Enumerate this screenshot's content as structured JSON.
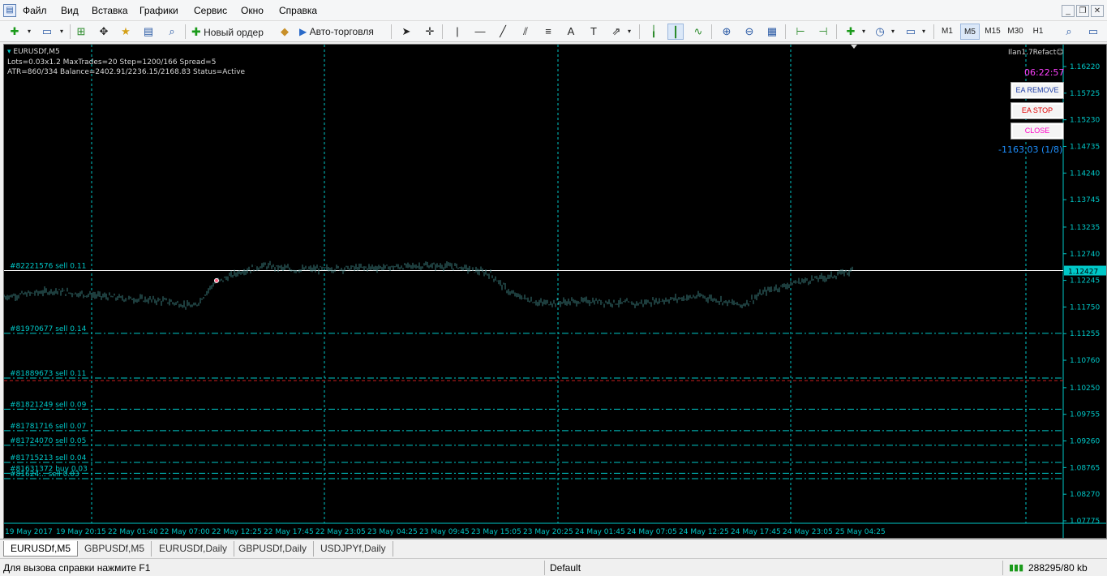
{
  "menu": {
    "items": [
      "Файл",
      "Вид",
      "Вставка",
      "Графики",
      "Сервис",
      "Окно",
      "Справка"
    ]
  },
  "toolbar": {
    "new_order_label": "Новый ордер",
    "auto_trading_label": "Авто-торговля",
    "timeframes": [
      "M1",
      "M5",
      "M15",
      "M30",
      "H1"
    ],
    "active_timeframe": "M5"
  },
  "chart": {
    "symbol_label": "EURUSDf,M5",
    "info_line_1": "Lots=0.03x1.2 MaxTrades=20 Step=1200/166 Spread=5",
    "info_line_2": "ATR=860/334 Balance=2402.91/2236.15/2168.83 Status=Active",
    "ea_name": "Ilan1.7Refact",
    "timer": "06:22:57",
    "ea_remove_label": "EA REMOVE",
    "ea_stop_label": "EA STOP",
    "close_label": "CLOSE",
    "profit_text": "-1163.03 (1/8)",
    "current_price": "1.12427",
    "price_scale": [
      "1.16220",
      "1.15725",
      "1.15230",
      "1.14735",
      "1.14240",
      "1.13745",
      "1.13235",
      "1.12740",
      "1.12245",
      "1.11750",
      "1.11255",
      "1.10760",
      "1.10250",
      "1.09755",
      "1.09260",
      "1.08765",
      "1.08270",
      "1.07775"
    ],
    "time_scale": [
      "19 May 2017",
      "19 May 20:15",
      "22 May 01:40",
      "22 May 07:00",
      "22 May 12:25",
      "22 May 17:45",
      "22 May 23:05",
      "23 May 04:25",
      "23 May 09:45",
      "23 May 15:05",
      "23 May 20:25",
      "24 May 01:45",
      "24 May 07:05",
      "24 May 12:25",
      "24 May 17:45",
      "24 May 23:05",
      "25 May 04:25"
    ],
    "orders": [
      {
        "label": "#82221576 sell 0.11",
        "price": 1.12427
      },
      {
        "label": "#81970677 sell 0.14",
        "price": 1.1126
      },
      {
        "label": "#81889673 sell 0.11",
        "price": 1.1043
      },
      {
        "label": "#81821249 sell 0.09",
        "price": 1.0985
      },
      {
        "label": "#81781716 sell 0.07",
        "price": 1.0945
      },
      {
        "label": "#81724070 sell 0.05",
        "price": 1.0918
      },
      {
        "label": "#81715213 sell 0.04",
        "price": 1.0886
      },
      {
        "label": "#81631372 buy 0.03",
        "price": 1.0866
      },
      {
        "label": "#81624... sell 0.03",
        "price": 1.0856
      }
    ],
    "colors": {
      "grid": "#00c8c8",
      "candles": "#3a7a7a",
      "price_line": "#ffffff",
      "profit": "#1e90ff",
      "timer": "#ff40ff"
    }
  },
  "tabs": [
    "EURUSDf,M5",
    "GBPUSDf,M5",
    "EURUSDf,Daily",
    "GBPUSDf,Daily",
    "USDJPYf,Daily"
  ],
  "active_tab": "EURUSDf,M5",
  "status": {
    "help_text": "Для вызова справки нажмите F1",
    "profile": "Default",
    "traffic": "288295/80 kb"
  }
}
